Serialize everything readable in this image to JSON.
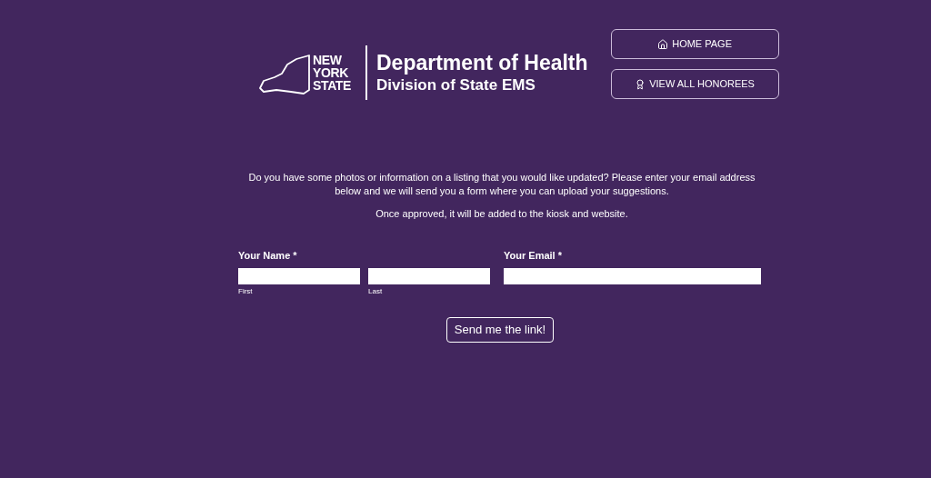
{
  "logo": {
    "state_lines": [
      "NEW",
      "YORK",
      "STATE"
    ],
    "department": "Department of Health",
    "division": "Division of State EMS"
  },
  "nav_buttons": [
    {
      "kind": "home",
      "label": "HOME PAGE"
    },
    {
      "kind": "honorees",
      "label": "VIEW ALL HONOREES"
    }
  ],
  "intro": [
    "Do you have some photos or information on a listing that you would like updated? Please enter your email address below and we will send you a form where you can upload your suggestions.",
    "Once approved, it will be added to the kiosk and website."
  ],
  "form": {
    "name_label": "Your Name *",
    "first_sublabel": "First",
    "last_sublabel": "Last",
    "email_label": "Your Email *",
    "submit": "Send me the link!"
  }
}
